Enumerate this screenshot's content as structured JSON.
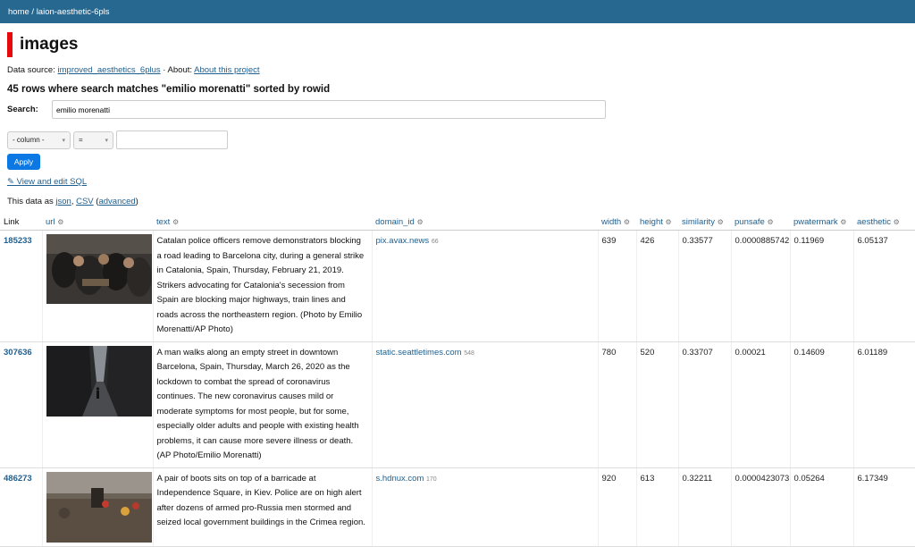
{
  "breadcrumb": {
    "home": "home",
    "sep": "/",
    "db": "laion-aesthetic-6pls"
  },
  "page_title": "images",
  "meta": {
    "data_source_label": "Data source:",
    "data_source": "improved_aesthetics_6plus",
    "about_label": "· About:",
    "about_link": "About this project"
  },
  "summary": "45 rows where search matches \"emilio morenatti\" sorted by rowid",
  "search": {
    "label": "Search:",
    "value": "emilio morenatti"
  },
  "filter": {
    "column": "- column -",
    "op": "=",
    "value": ""
  },
  "apply_label": "Apply",
  "view_sql": "✎ View and edit SQL",
  "export": {
    "prefix": "This data as",
    "json": "json",
    "csv": "CSV",
    "advanced": "advanced"
  },
  "columns": [
    "Link",
    "url",
    "text",
    "domain_id",
    "width",
    "height",
    "similarity",
    "punsafe",
    "pwatermark",
    "aesthetic"
  ],
  "rows": [
    {
      "link": "185233",
      "text": "Catalan police officers remove demonstrators blocking a road leading to Barcelona city, during a general strike in Catalonia, Spain, Thursday, February 21, 2019. Strikers advocating for Catalonia's secession from Spain are blocking major highways, train lines and roads across the northeastern region. (Photo by Emilio Morenatti/AP Photo)",
      "domain": "pix.avax.news",
      "domain_count": "66",
      "width": "639",
      "height": "426",
      "similarity": "0.33577",
      "punsafe": "0.0000885742",
      "pwatermark": "0.11969",
      "aesthetic": "6.05137"
    },
    {
      "link": "307636",
      "text": "A man walks along an empty street in downtown Barcelona, Spain, Thursday, March 26, 2020 as the lockdown to combat the spread of coronavirus continues. The new coronavirus causes mild or moderate symptoms for most people, but for some, especially older adults and people with existing health problems, it can cause more severe illness or death. (AP Photo/Emilio Morenatti)",
      "domain": "static.seattletimes.com",
      "domain_count": "548",
      "width": "780",
      "height": "520",
      "similarity": "0.33707",
      "punsafe": "0.00021",
      "pwatermark": "0.14609",
      "aesthetic": "6.01189"
    },
    {
      "link": "486273",
      "text": "A pair of boots sits on top of a barricade at Independence Square, in Kiev. Police are on high alert after dozens of armed pro-Russia men stormed and seized local government buildings in the Crimea region.",
      "domain": "s.hdnux.com",
      "domain_count": "170",
      "width": "920",
      "height": "613",
      "similarity": "0.32211",
      "punsafe": "0.0000423073",
      "pwatermark": "0.05264",
      "aesthetic": "6.17349"
    }
  ]
}
